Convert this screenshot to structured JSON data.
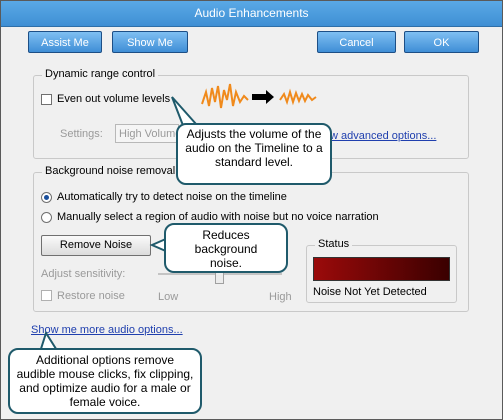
{
  "window": {
    "title": "Audio Enhancements"
  },
  "toolbar": {
    "assist_label": "Assist Me",
    "show_label": "Show Me",
    "cancel_label": "Cancel",
    "ok_label": "OK"
  },
  "dynamic_range": {
    "legend": "Dynamic range control",
    "even_out_label": "Even out volume levels",
    "settings_label": "Settings:",
    "settings_value": "High Volume",
    "advanced_link": "w advanced options..."
  },
  "noise": {
    "legend": "Background noise removal",
    "auto_label": "Automatically try to detect noise on the timeline",
    "manual_label": "Manually select a region of audio with noise but no voice narration",
    "remove_button": "Remove Noise",
    "sensitivity_label": "Adjust sensitivity:",
    "low_label": "Low",
    "high_label": "High",
    "restore_label": "Restore noise",
    "status_legend": "Status",
    "status_text": "Noise Not Yet Detected",
    "status_color": "#9b0a0a"
  },
  "more_options_link": "Show me more audio options...",
  "callouts": {
    "volume": "Adjusts the volume of the audio on the Timeline to a standard level.",
    "noise": "Reduces background noise.",
    "more": "Additional options remove audible mouse clicks, fix clipping, and optimize audio for a male or female voice."
  },
  "icons": {
    "waveform": "waveform-icon",
    "arrow": "arrow-right-icon"
  }
}
